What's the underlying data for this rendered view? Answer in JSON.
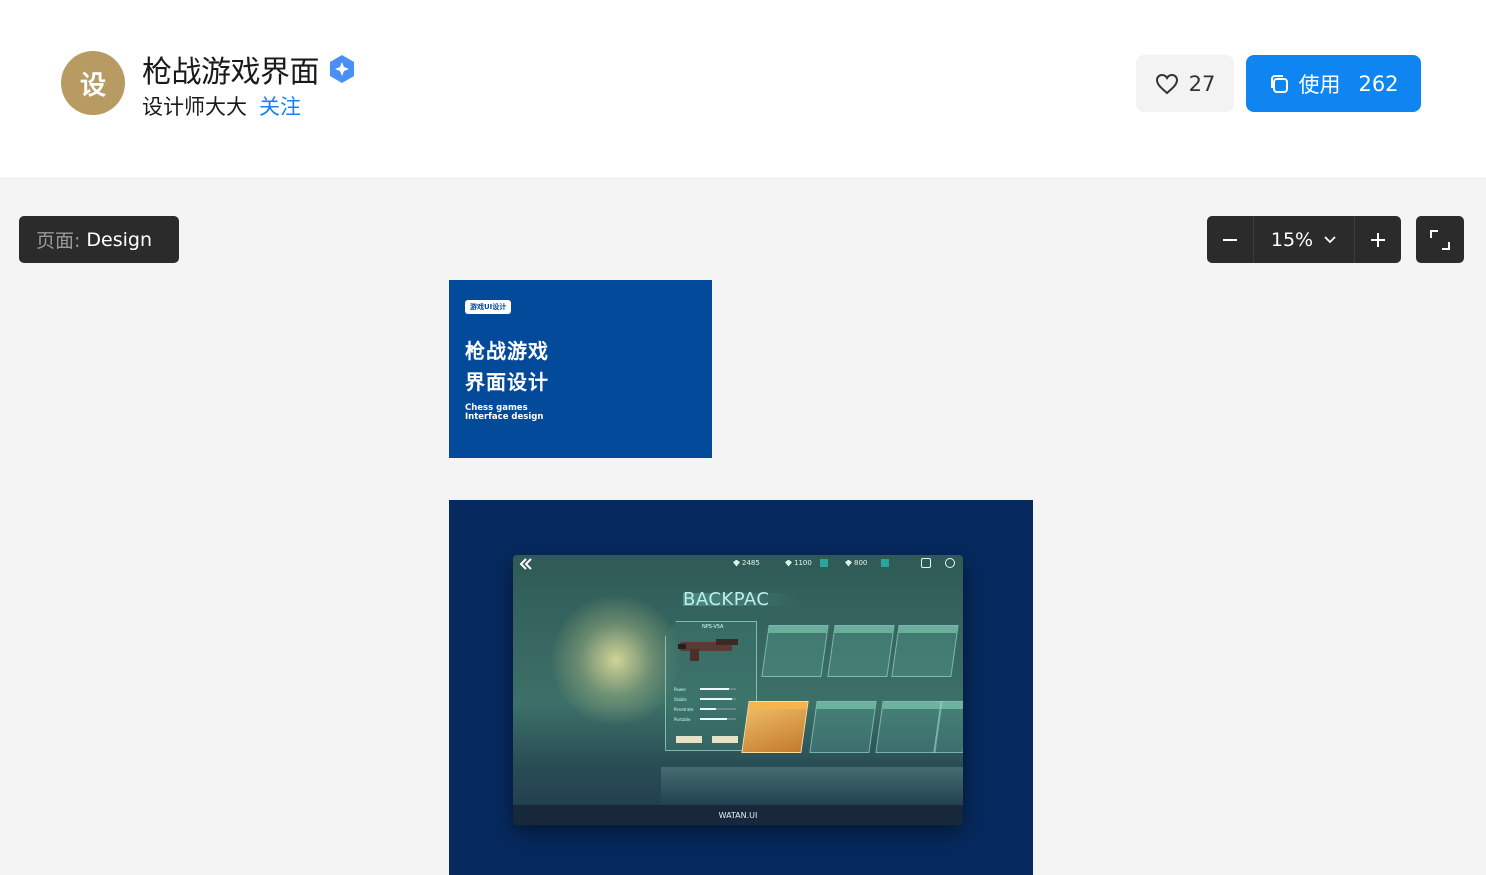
{
  "header": {
    "avatar_text": "设",
    "title": "枪战游戏界面",
    "author": "设计师大大",
    "follow_label": "关注",
    "like_count": "27",
    "use_label": "使用",
    "use_count": "262"
  },
  "canvas_toolbar": {
    "page_label": "页面:",
    "page_name": "Design",
    "zoom_value": "15%"
  },
  "cover_frame": {
    "tag": "游戏UI设计",
    "title_line1": "枪战游戏",
    "title_line2": "界面设计",
    "subtitle_line1": "Chess games",
    "subtitle_line2": "Interface design",
    "background_color": "#044a9a"
  },
  "game_frame": {
    "stats": [
      "2485",
      "1100",
      "800"
    ],
    "screen_title": "BACKPAC",
    "weapon_name": "NPS-V5A",
    "weapon_stats": [
      {
        "label": "Power",
        "level": 0.8
      },
      {
        "label": "Stable",
        "level": 0.9
      },
      {
        "label": "Penetrate",
        "level": 0.45
      },
      {
        "label": "Portable",
        "level": 0.75
      }
    ],
    "footer_text": "WATAN.UI"
  },
  "colors": {
    "primary_blue": "#0f85f2",
    "dark_toolbar": "#2b2b2b",
    "avatar_gold": "#b89a63"
  }
}
